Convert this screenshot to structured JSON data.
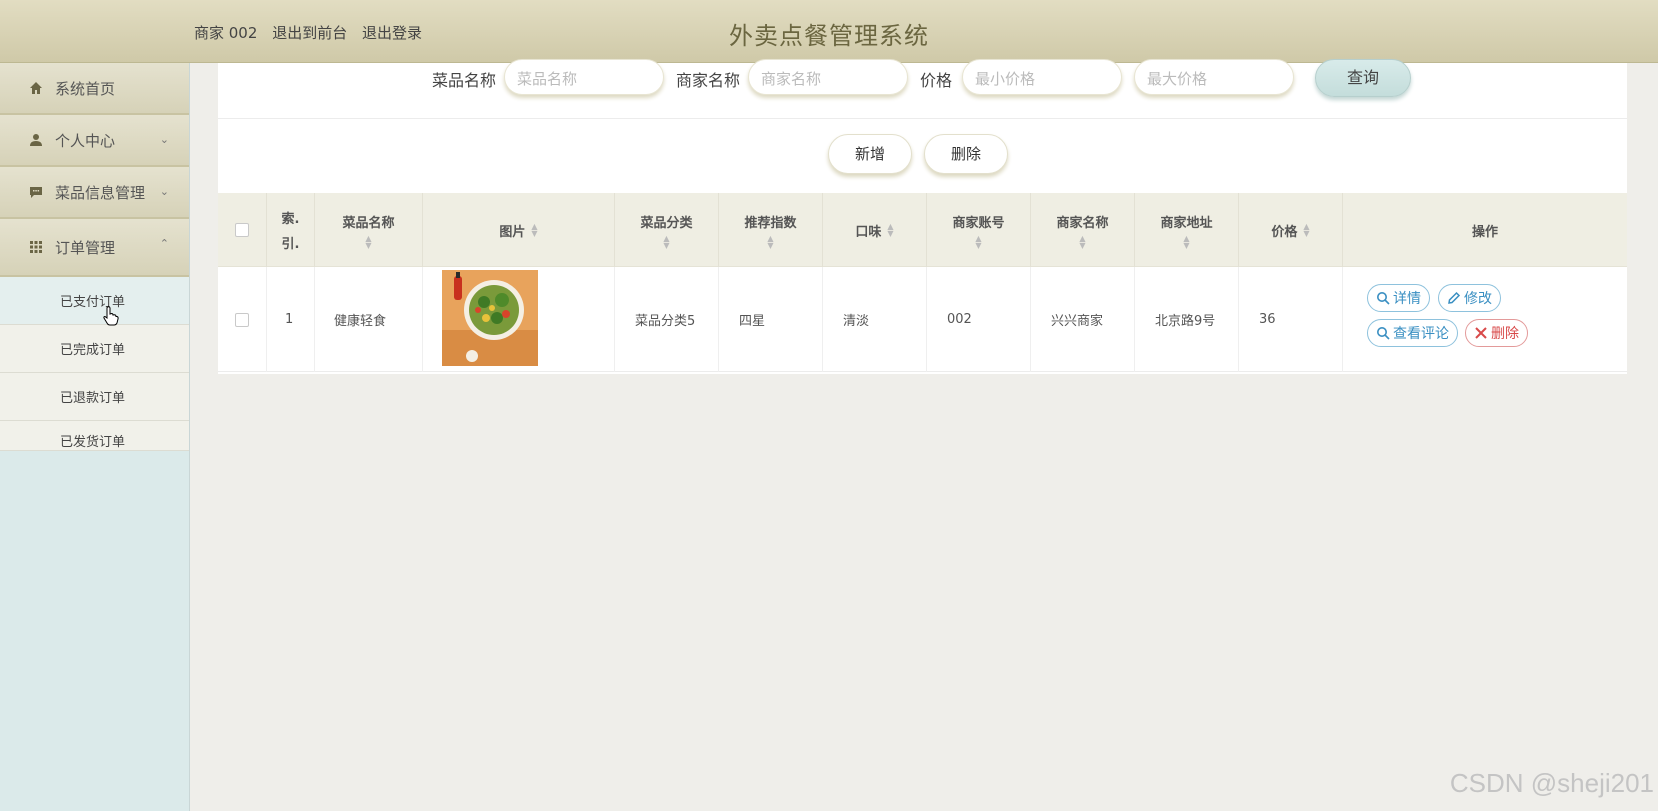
{
  "header": {
    "user": "商家 002",
    "to_front": "退出到前台",
    "logout": "退出登录",
    "title": "外卖点餐管理系统"
  },
  "sidebar": {
    "items": [
      {
        "label": "系统首页",
        "icon": "home-icon"
      },
      {
        "label": "个人中心",
        "icon": "user-icon"
      },
      {
        "label": "菜品信息管理",
        "icon": "chat-icon"
      },
      {
        "label": "订单管理",
        "icon": "grid-icon"
      }
    ],
    "sub_items": [
      "已支付订单",
      "已完成订单",
      "已退款订单",
      "已发货订单"
    ]
  },
  "search": {
    "dish_label": "菜品名称",
    "dish_placeholder": "菜品名称",
    "merchant_label": "商家名称",
    "merchant_placeholder": "商家名称",
    "price_label": "价格",
    "min_placeholder": "最小价格",
    "max_placeholder": "最大价格",
    "query_button": "查询"
  },
  "actions": {
    "add": "新增",
    "delete": "删除"
  },
  "table": {
    "headers": {
      "index_1": "索.",
      "index_2": "引.",
      "dish_name": "菜品名称",
      "image": "图片",
      "category": "菜品分类",
      "rating": "推荐指数",
      "taste": "口味",
      "merchant_account": "商家账号",
      "merchant_name": "商家名称",
      "merchant_address": "商家地址",
      "price": "价格",
      "operation": "操作"
    },
    "rows": [
      {
        "index": "1",
        "dish_name": "健康轻食",
        "category": "菜品分类5",
        "rating": "四星",
        "taste": "清淡",
        "merchant_account": "002",
        "merchant_name": "兴兴商家",
        "merchant_address": "北京路9号",
        "price": "36"
      }
    ],
    "ops": {
      "detail": "详情",
      "edit": "修改",
      "reviews": "查看评论",
      "delete": "删除"
    }
  },
  "watermark": "CSDN @sheji201",
  "colors": {
    "header_bg": "#d8d3b5",
    "title": "#6b6640",
    "sidebar_bg": "#dbeaea",
    "op_blue": "#3a8fc2",
    "op_red": "#d84a4a"
  }
}
